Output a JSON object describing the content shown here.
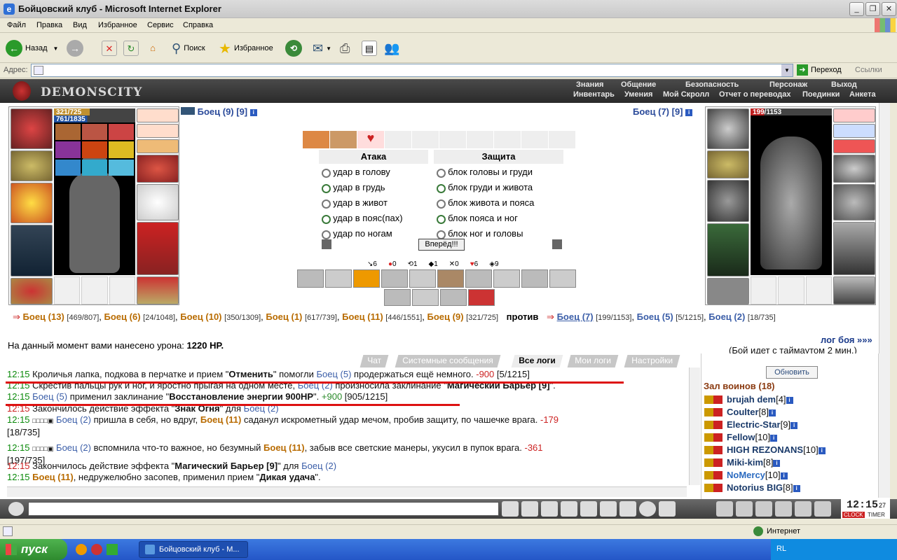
{
  "window": {
    "title": "Бойцовский клуб - Microsoft Internet Explorer"
  },
  "menu": [
    "Файл",
    "Правка",
    "Вид",
    "Избранное",
    "Сервис",
    "Справка"
  ],
  "toolbar": {
    "back": "Назад",
    "search": "Поиск",
    "favorites": "Избранное"
  },
  "address": {
    "label": "Адрес:",
    "value": "",
    "go": "Переход",
    "links": "Ссылки"
  },
  "game_header": {
    "logo": "DEMONSCITY",
    "nav_top": [
      "Знания",
      "Общение",
      "Безопасность",
      "Персонаж",
      "Выход"
    ],
    "nav_bottom": [
      "Инвентарь",
      "Умения",
      "Мой Скролл",
      "Отчет о переводах",
      "Поединки",
      "Анкета"
    ]
  },
  "player_left": {
    "name": "Боец (9) [9]",
    "hp": "321/725",
    "mana": "761/1835"
  },
  "player_right": {
    "name": "Боец (7) [9]",
    "hp": "199/1153"
  },
  "combat": {
    "attack_title": "Атака",
    "defense_title": "Защита",
    "attacks": [
      {
        "label": "удар в голову",
        "selected": false
      },
      {
        "label": "удар в грудь",
        "selected": true
      },
      {
        "label": "удар в живот",
        "selected": false
      },
      {
        "label": "удар в пояс(пах)",
        "selected": true
      },
      {
        "label": "удар по ногам",
        "selected": false
      }
    ],
    "defenses": [
      {
        "label": "блок головы и груди",
        "selected": false
      },
      {
        "label": "блок груди и живота",
        "selected": true
      },
      {
        "label": "блок живота и пояса",
        "selected": false
      },
      {
        "label": "блок пояса и ног",
        "selected": true
      },
      {
        "label": "блок ног и головы",
        "selected": false
      }
    ],
    "forward_button": "Вперёд!!!",
    "counters": [
      "6",
      "0",
      "1",
      "1",
      "0",
      "6",
      "9"
    ]
  },
  "teams": {
    "left": [
      {
        "name": "Боец (13)",
        "hp": "[469/807]"
      },
      {
        "name": "Боец (6)",
        "hp": "[24/1048]"
      },
      {
        "name": "Боец (10)",
        "hp": "[350/1309]"
      },
      {
        "name": "Боец (1)",
        "hp": "[617/739]"
      },
      {
        "name": "Боец (11)",
        "hp": "[446/1551]"
      },
      {
        "name": "Боец (9)",
        "hp": "[321/725]"
      }
    ],
    "vs": "против",
    "right": [
      {
        "name": "Боец (7)",
        "hp": "[199/1153]"
      },
      {
        "name": "Боец (5)",
        "hp": "[5/1215]"
      },
      {
        "name": "Боец (2)",
        "hp": "[18/735]"
      }
    ]
  },
  "damage": {
    "label": "На данный момент вами нанесено урона:",
    "value": "1220 HP."
  },
  "battle_log_link": "лог боя »»»",
  "battle_timeout": "(Бой идет с таймаутом 2 мин.)",
  "chat_tabs": [
    "Чат",
    "Системные сообщения",
    "Все логи",
    "Мои логи",
    "Настройки"
  ],
  "chat_active_tab": "Все логи",
  "log": [
    {
      "time": "12:15",
      "parts": [
        "Кроличья лапка, подкова в перчатке и прием \"",
        "Отменить",
        "\" помогли ",
        "Боец (5)",
        " продержаться ещё немного. ",
        "-900",
        " [5/1215]"
      ]
    },
    {
      "time": "12:15",
      "parts": [
        "Скрестив пальцы рук и ног, и яростно прыгая на одном месте, ",
        "Боец (2)",
        " произносила заклинание \"",
        "Магический Барьер [9]",
        "\"."
      ]
    },
    {
      "time": "12:15",
      "parts": [
        "Боец (5)",
        " применил заклинание \"",
        "Восстановление энергии 900HP",
        "\". ",
        "+900",
        " [905/1215]"
      ]
    },
    {
      "time": "12:15",
      "parts": [
        "Закончилось действие эффекта \"",
        "Знак Огня",
        "\" для ",
        "Боец (2)"
      ]
    },
    {
      "time": "12:15",
      "parts": [
        "Боец (2)",
        " пришла в себя, но вдруг, ",
        "Боец (11)",
        " саданул искрометный удар мечом, пробив защиту, по чашечке врага. ",
        "-179"
      ],
      "cont": "[18/735]"
    },
    {
      "time": "12:15",
      "parts": [
        "Боец (2)",
        " вспомнила что-то важное, но безумный ",
        "Боец (11)",
        ", забыв все светские манеры, укусил в пупок врага. ",
        "-361"
      ],
      "cont": "[197/735]"
    },
    {
      "time": "12:15",
      "parts": [
        "Закончилось действие эффекта \"",
        "Магический Барьер [9]",
        "\" для ",
        "Боец (2)"
      ]
    },
    {
      "time": "12:15",
      "parts": [
        "Боец (11)",
        ", недружелюбно засопев, применил прием \"",
        "Дикая удача",
        "\"."
      ]
    }
  ],
  "room": {
    "refresh_button": "Обновить",
    "title": "Зал воинов (18)",
    "users": [
      {
        "name": "brujah dem",
        "level": "[4]"
      },
      {
        "name": "Coulter",
        "level": "[8]"
      },
      {
        "name": "Electric-Star",
        "level": "[9]"
      },
      {
        "name": "Fellow",
        "level": "[10]"
      },
      {
        "name": "HIGH REZONANS",
        "level": "[10]"
      },
      {
        "name": "Miki-kim",
        "level": "[8]"
      },
      {
        "name": "NoMercy",
        "level": "[10]"
      },
      {
        "name": "Notorius BIG",
        "level": "[8]"
      }
    ]
  },
  "clock": {
    "time": "12:15",
    "seconds": "27",
    "label1": "CLOCK",
    "label2": "TIMER"
  },
  "status": {
    "zone": "Интернет"
  },
  "taskbar": {
    "start": "пуск",
    "task": "Бойцовский клуб - M...",
    "lang": "RL"
  }
}
